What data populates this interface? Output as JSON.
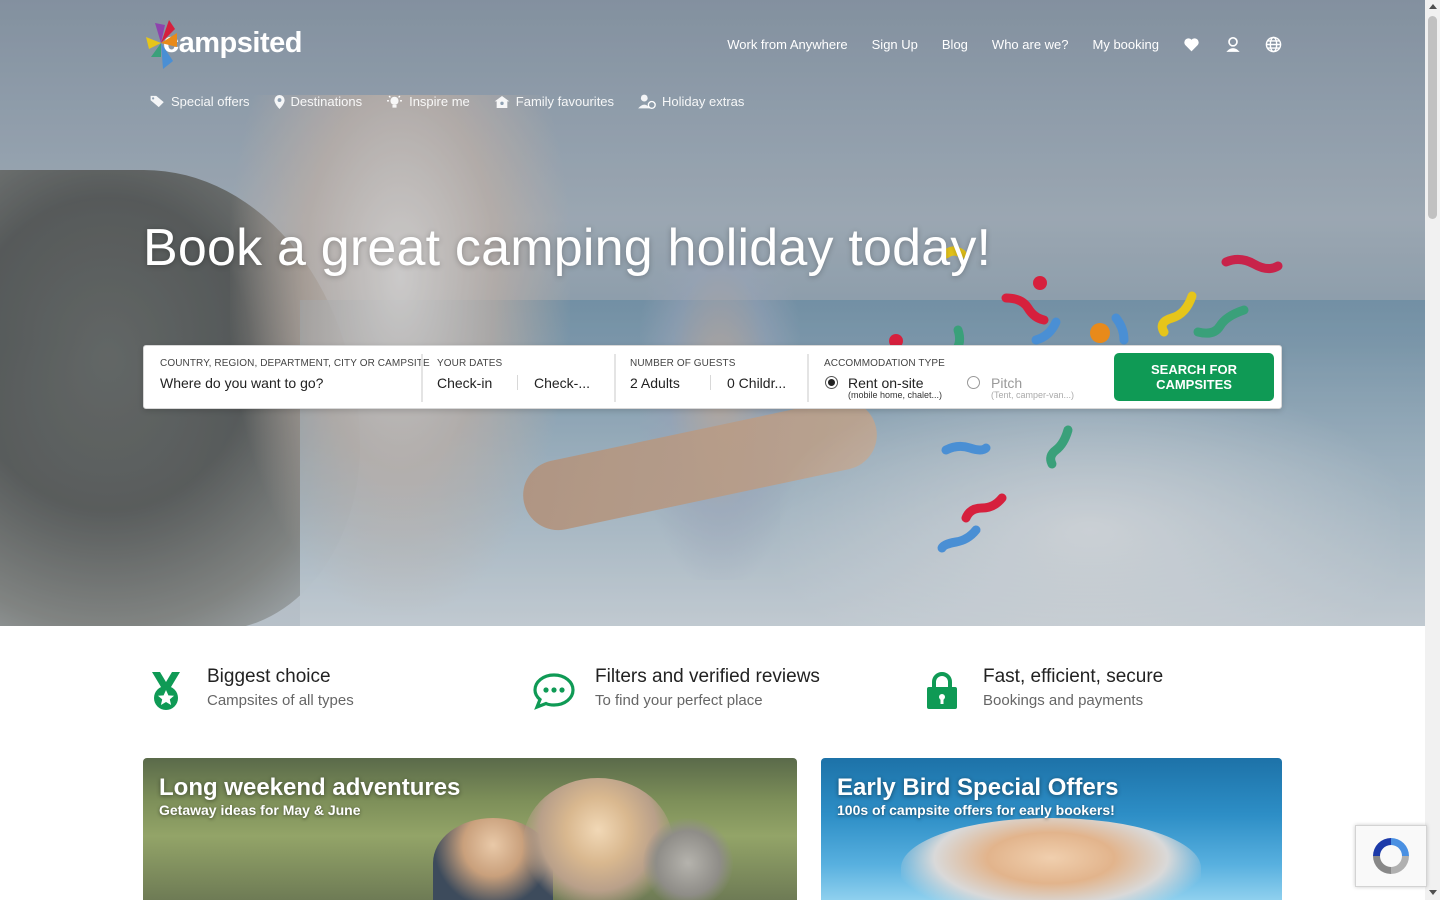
{
  "brand": {
    "name": "campsited"
  },
  "topnav": {
    "items": [
      "Work from Anywhere",
      "Sign Up",
      "Blog",
      "Who are we?",
      "My booking"
    ],
    "icons": [
      "heart-icon",
      "user-icon",
      "globe-icon"
    ]
  },
  "subnav": {
    "items": [
      {
        "label": "Special offers",
        "icon": "tag-icon"
      },
      {
        "label": "Destinations",
        "icon": "location-pin-icon"
      },
      {
        "label": "Inspire me",
        "icon": "lightbulb-icon"
      },
      {
        "label": "Family favourites",
        "icon": "family-house-icon"
      },
      {
        "label": "Holiday extras",
        "icon": "holiday-extras-icon"
      }
    ]
  },
  "hero": {
    "headline": "Book a great camping holiday today!"
  },
  "search": {
    "destination": {
      "label": "COUNTRY, REGION, DEPARTMENT, CITY OR CAMPSITE",
      "placeholder": "Where do you want to go?"
    },
    "dates": {
      "label": "YOUR DATES",
      "checkin": "Check-in",
      "checkout": "Check-..."
    },
    "guests": {
      "label": "NUMBER OF GUESTS",
      "adults": "2 Adults",
      "children": "0 Childr..."
    },
    "accommodation": {
      "label": "ACCOMMODATION TYPE",
      "options": [
        {
          "label": "Rent on-site",
          "sub": "(mobile home, chalet...)",
          "selected": true
        },
        {
          "label": "Pitch",
          "sub": "(Tent, camper-van...)",
          "selected": false
        }
      ]
    },
    "button": "SEARCH FOR CAMPSITES"
  },
  "features": [
    {
      "title": "Biggest choice",
      "subtitle": "Campsites of all types",
      "icon": "medal-icon"
    },
    {
      "title": "Filters and verified reviews",
      "subtitle": "To find your perfect place",
      "icon": "chat-bubble-icon"
    },
    {
      "title": "Fast, efficient, secure",
      "subtitle": "Bookings and payments",
      "icon": "lock-icon"
    }
  ],
  "cards": [
    {
      "title": "Long weekend adventures",
      "subtitle": "Getaway ideas for May & June"
    },
    {
      "title": "Early Bird Special Offers",
      "subtitle": "100s of campsite offers for early bookers!"
    }
  ],
  "colors": {
    "accent": "#0f9a55",
    "text": "#222222",
    "muted": "#666666"
  }
}
